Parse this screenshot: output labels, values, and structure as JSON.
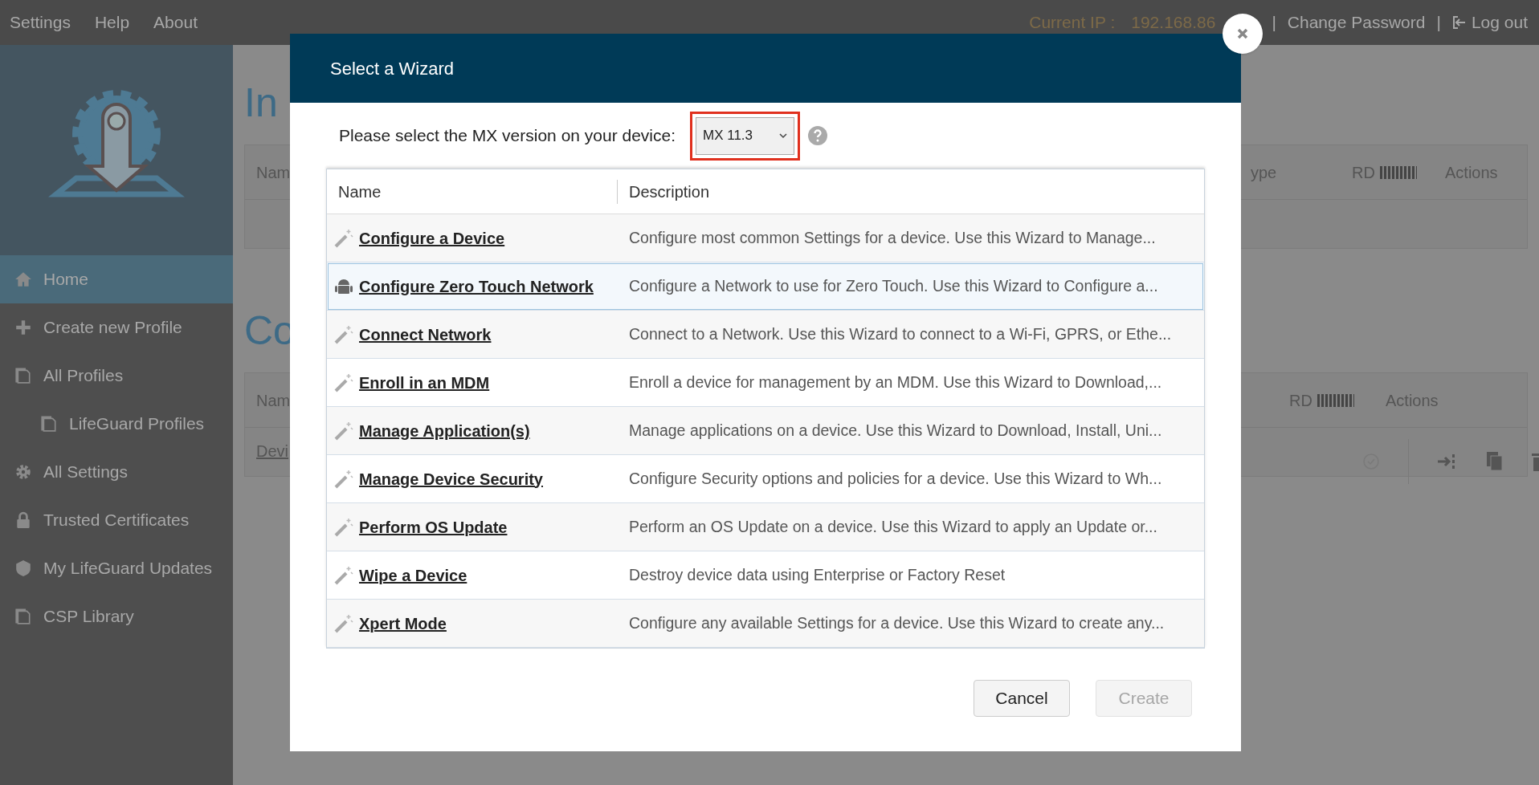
{
  "top_nav": [
    "Settings",
    "Help",
    "About"
  ],
  "top_right": {
    "ip_label": "Current IP :",
    "ip_value": "192.168.86",
    "separator": "|",
    "change_password": "Change Password",
    "separator_2": "|",
    "logout": "Log out"
  },
  "sidebar": {
    "items": [
      {
        "label": "Home",
        "kind": "home",
        "selected": true
      },
      {
        "label": "Create new Profile",
        "kind": "create",
        "selected": false
      },
      {
        "label": "All Profiles",
        "kind": "document",
        "selected": false,
        "children": [
          {
            "label": "LifeGuard Profiles",
            "kind": "document",
            "selected": false
          }
        ]
      },
      {
        "label": "All Settings",
        "kind": "settings",
        "selected": false
      },
      {
        "label": "Trusted Certificates",
        "kind": "security",
        "selected": false
      },
      {
        "label": "My LifeGuard Updates",
        "kind": "updates",
        "selected": false
      },
      {
        "label": "CSP Library",
        "kind": "document",
        "selected": false
      }
    ]
  },
  "background": {
    "sections": [
      {
        "heading": "In",
        "columns": [
          "Nam",
          "ype",
          "RD",
          "Actions"
        ]
      },
      {
        "heading": "Co",
        "columns": [
          "Nam",
          "RD",
          "Actions"
        ],
        "rows": [
          {
            "name": "Devi"
          }
        ]
      }
    ]
  },
  "dialog": {
    "title": "Select a Wizard",
    "version_label": "Please select the MX version on your device:",
    "version_value": "MX 11.3",
    "columns": [
      "Name",
      "Description"
    ],
    "rows": [
      {
        "name": "Configure a Device",
        "description": "Configure most common Settings for a device. Use this Wizard to Manage...",
        "kind": "wand",
        "selected": false
      },
      {
        "name": "Configure Zero Touch Network",
        "description": "Configure a Network to use for Zero Touch. Use this Wizard to Configure a...",
        "kind": "android",
        "selected": true
      },
      {
        "name": "Connect Network",
        "description": "Connect to a Network. Use this Wizard to connect to a Wi-Fi, GPRS, or Ethe...",
        "kind": "wand",
        "selected": false
      },
      {
        "name": "Enroll in an MDM",
        "description": "Enroll a device for management by an MDM.  Use this Wizard to Download,...",
        "kind": "wand",
        "selected": false
      },
      {
        "name": "Manage Application(s)",
        "description": "Manage applications on a device.  Use this Wizard to Download, Install, Uni...",
        "kind": "wand",
        "selected": false
      },
      {
        "name": "Manage Device Security",
        "description": "Configure Security options and policies for a device.  Use this Wizard to Wh...",
        "kind": "wand",
        "selected": false
      },
      {
        "name": "Perform OS Update",
        "description": "Perform an OS Update on a device.  Use this Wizard to apply an Update or...",
        "kind": "wand",
        "selected": false
      },
      {
        "name": "Wipe a Device",
        "description": "Destroy device data using Enterprise or Factory Reset",
        "kind": "wand",
        "selected": false
      },
      {
        "name": "Xpert Mode",
        "description": "Configure any available Settings for a device. Use this Wizard to create any...",
        "kind": "wand",
        "selected": false
      }
    ],
    "buttons": [
      {
        "label": "Cancel",
        "disabled": false
      },
      {
        "label": "Create",
        "disabled": true
      }
    ]
  }
}
